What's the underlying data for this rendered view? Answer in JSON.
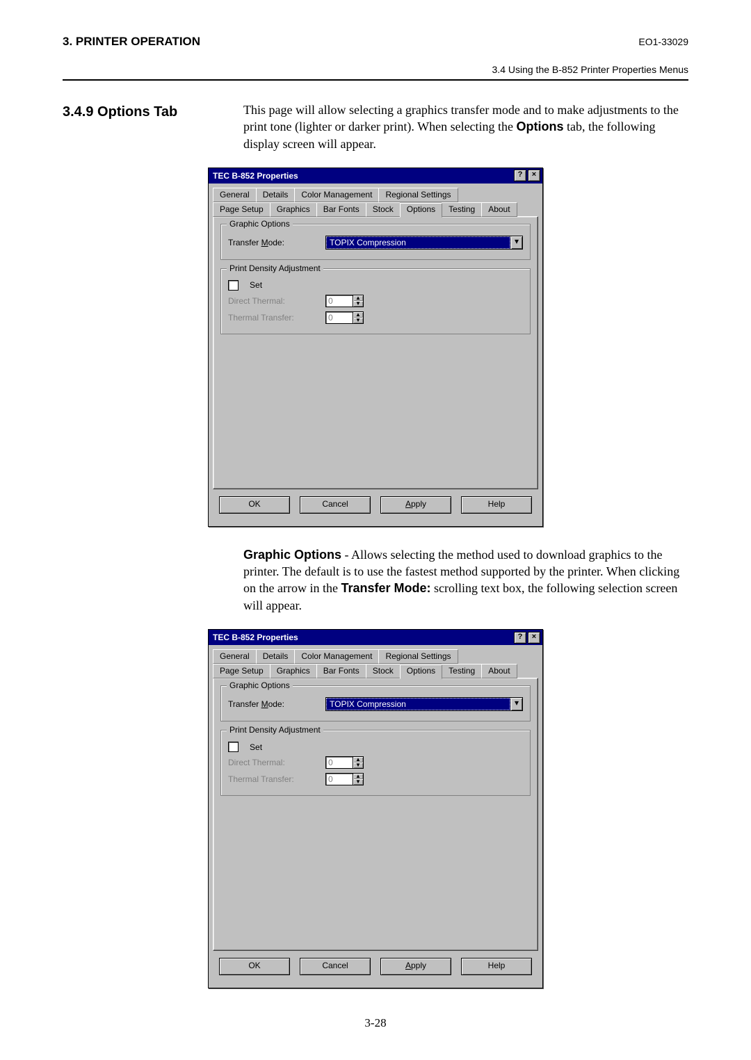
{
  "header": {
    "left": "3. PRINTER OPERATION",
    "right": "EO1-33029",
    "sub": "3.4 Using the B-852 Printer Properties Menus"
  },
  "section": {
    "number_title": "3.4.9  Options Tab",
    "intro_a": "This page will allow selecting a graphics transfer mode and to make adjustments to the print tone (lighter or darker print). When selecting the ",
    "intro_b_bold": "Options",
    "intro_c": " tab, the following display screen will appear."
  },
  "dialog": {
    "title": "TEC B-852 Properties",
    "tb_help": "?",
    "tb_close": "×",
    "tabs_row1": [
      "General",
      "Details",
      "Color Management",
      "Regional Settings"
    ],
    "tabs_row2": [
      "Page Setup",
      "Graphics",
      "Bar Fonts",
      "Stock",
      "Options",
      "Testing",
      "About"
    ],
    "active_tab": "Options",
    "group_graphic": "Graphic Options",
    "transfer_mode_label": "Transfer Mode:",
    "transfer_mode_u": "M",
    "transfer_mode_value": "TOPIX Compression",
    "group_density": "Print Density Adjustment",
    "set_label": "Set",
    "set_u": "S",
    "direct_thermal_label": "Direct Thermal:",
    "thermal_transfer_label": "Thermal Transfer:",
    "spin_value": "0",
    "buttons": {
      "ok": "OK",
      "cancel": "Cancel",
      "apply": "Apply",
      "apply_u": "A",
      "help": "Help"
    }
  },
  "mid": {
    "a_bold": "Graphic Options",
    "a_rest": " - Allows selecting the method used to download graphics to the printer. The default is to use the fastest method supported by the printer. When clicking on the arrow in the ",
    "b_bold": "Transfer Mode:",
    "b_rest": "  scrolling text box, the following selection screen will appear."
  },
  "page_number": "3-28"
}
